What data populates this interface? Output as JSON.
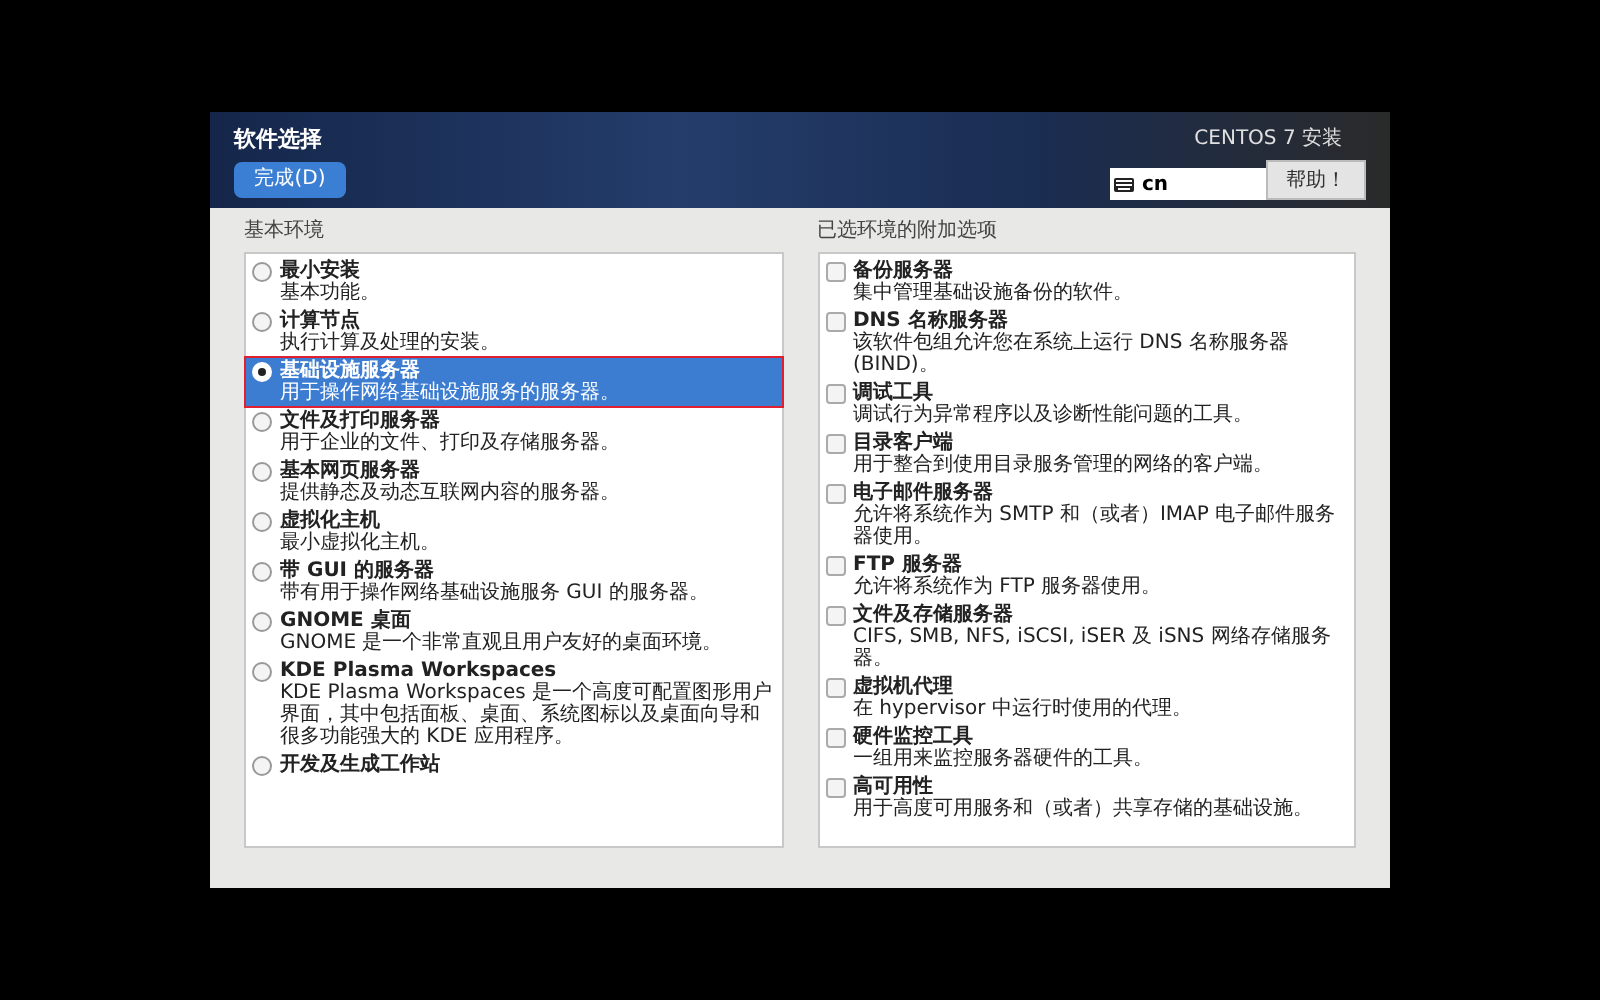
{
  "header": {
    "title": "软件选择",
    "done_button": "完成(D)",
    "product": "CENTOS 7 安装",
    "keyboard_layout": "cn",
    "help_button": "帮助！"
  },
  "environments": {
    "heading": "基本环境",
    "items": [
      {
        "name": "最小安装",
        "description": "基本功能。",
        "selected": false,
        "annotated": false
      },
      {
        "name": "计算节点",
        "description": "执行计算及处理的安装。",
        "selected": false,
        "annotated": false
      },
      {
        "name": "基础设施服务器",
        "description": "用于操作网络基础设施服务的服务器。",
        "selected": true,
        "annotated": true
      },
      {
        "name": "文件及打印服务器",
        "description": "用于企业的文件、打印及存储服务器。",
        "selected": false,
        "annotated": false
      },
      {
        "name": "基本网页服务器",
        "description": "提供静态及动态互联网内容的服务器。",
        "selected": false,
        "annotated": false
      },
      {
        "name": "虚拟化主机",
        "description": "最小虚拟化主机。",
        "selected": false,
        "annotated": false
      },
      {
        "name": "带 GUI 的服务器",
        "description": "带有用于操作网络基础设施服务 GUI 的服务器。",
        "selected": false,
        "annotated": false
      },
      {
        "name": "GNOME 桌面",
        "description": "GNOME 是一个非常直观且用户友好的桌面环境。",
        "selected": false,
        "annotated": false
      },
      {
        "name": "KDE Plasma Workspaces",
        "description": "KDE Plasma Workspaces 是一个高度可配置图形用户界面，其中包括面板、桌面、系统图标以及桌面向导和很多功能强大的 KDE 应用程序。",
        "selected": false,
        "annotated": false
      },
      {
        "name": "开发及生成工作站",
        "selected": false,
        "annotated": false
      }
    ]
  },
  "addons": {
    "heading": "已选环境的附加选项",
    "items": [
      {
        "name": "备份服务器",
        "description": "集中管理基础设施备份的软件。",
        "checked": false
      },
      {
        "name": "DNS 名称服务器",
        "description": "该软件包组允许您在系统上运行 DNS 名称服务器(BIND)。",
        "checked": false
      },
      {
        "name": "调试工具",
        "description": "调试行为异常程序以及诊断性能问题的工具。",
        "checked": false
      },
      {
        "name": "目录客户端",
        "description": "用于整合到使用目录服务管理的网络的客户端。",
        "checked": false
      },
      {
        "name": "电子邮件服务器",
        "description": "允许将系统作为 SMTP 和（或者）IMAP 电子邮件服务器使用。",
        "checked": false
      },
      {
        "name": "FTP 服务器",
        "description": "允许将系统作为 FTP 服务器使用。",
        "checked": false
      },
      {
        "name": "文件及存储服务器",
        "description": "CIFS, SMB, NFS, iSCSI, iSER 及 iSNS 网络存储服务器。",
        "checked": false
      },
      {
        "name": "虚拟机代理",
        "description": "在 hypervisor 中运行时使用的代理。",
        "checked": false
      },
      {
        "name": "硬件监控工具",
        "description": "一组用来监控服务器硬件的工具。",
        "checked": false
      },
      {
        "name": "高可用性",
        "description": "用于高度可用服务和（或者）共享存储的基础设施。",
        "checked": false
      }
    ]
  }
}
